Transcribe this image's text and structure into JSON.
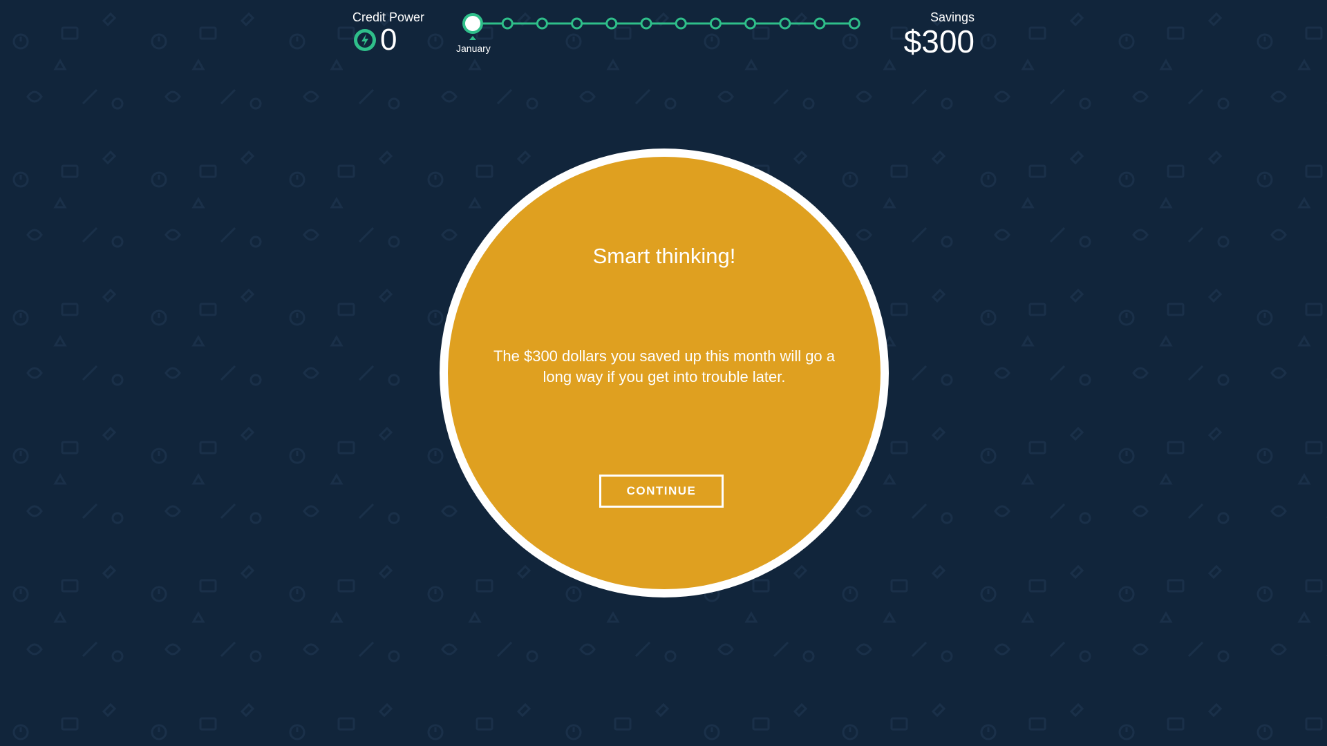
{
  "hud": {
    "credit_power_label": "Credit Power",
    "credit_power_value": "0",
    "savings_label": "Savings",
    "savings_value": "$300"
  },
  "timeline": {
    "current_month": "January",
    "total_months": 12,
    "current_index": 0
  },
  "modal": {
    "title": "Smart thinking!",
    "body": "The $300 dollars you saved up this month will go a long way if you get into trouble later.",
    "button_label": "CONTINUE"
  },
  "colors": {
    "background": "#11253b",
    "accent": "#2fbf8a",
    "modal_fill": "#dfa020",
    "modal_ring": "#ffffff"
  },
  "icons": {
    "credit_power": "lightning-bolt-icon"
  }
}
